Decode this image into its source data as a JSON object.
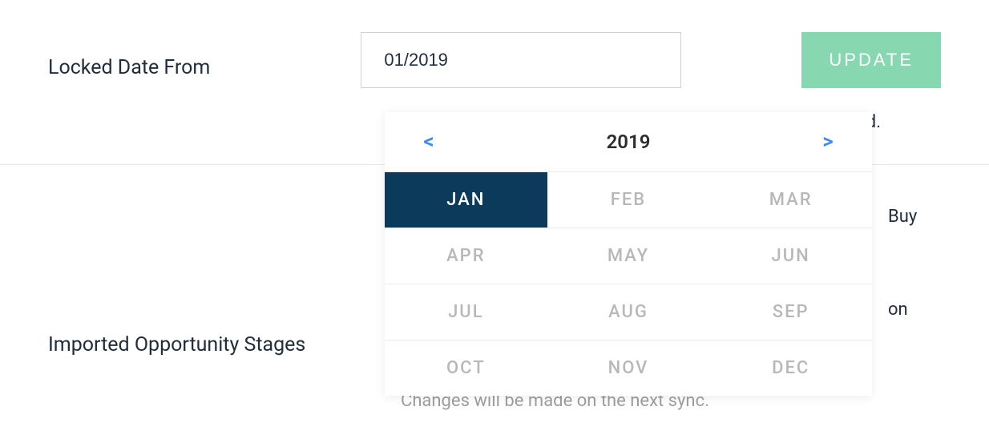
{
  "locked_date": {
    "label": "Locked Date From",
    "value": "01/2019",
    "update_btn": "UPDATE",
    "help_suffix": "ed."
  },
  "stages": {
    "label": "Imported Opportunity Stages",
    "items": [
      {
        "checked": true,
        "text_suffix": "Buy"
      },
      {
        "checked": true,
        "text_suffix": ""
      },
      {
        "checked": true,
        "text_suffix": "on"
      },
      {
        "checked": false,
        "text_suffix": ""
      }
    ],
    "help": "Changes will be made on the next sync."
  },
  "datepicker": {
    "year": "2019",
    "prev": "<",
    "next": ">",
    "months": [
      "JAN",
      "FEB",
      "MAR",
      "APR",
      "MAY",
      "JUN",
      "JUL",
      "AUG",
      "SEP",
      "OCT",
      "NOV",
      "DEC"
    ],
    "selected": "JAN"
  }
}
